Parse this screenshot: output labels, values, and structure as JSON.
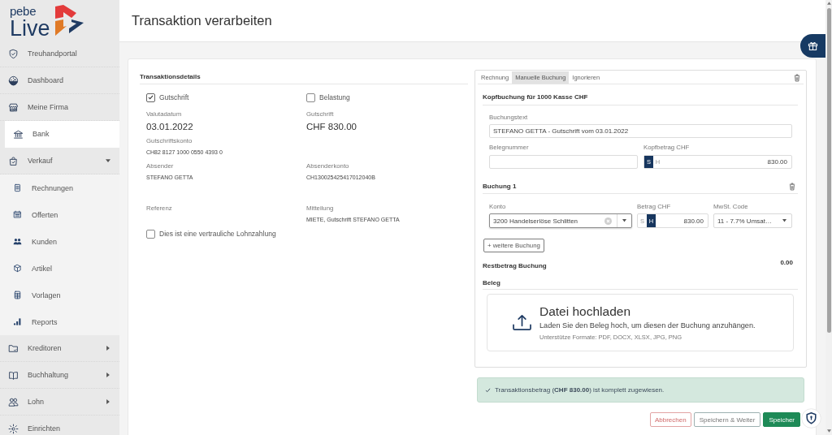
{
  "sidebar": {
    "logo": {
      "top": "pebe",
      "bottom": "Live"
    },
    "items": [
      {
        "label": "Treuhandportal",
        "kind": "link",
        "selected": false
      },
      {
        "label": "Dashboard",
        "kind": "link",
        "selected": false
      },
      {
        "label": "Meine Firma",
        "kind": "link",
        "selected": false
      },
      {
        "label": "Bank",
        "kind": "link",
        "selected": true
      },
      {
        "label": "Verkauf",
        "kind": "group",
        "selected": false,
        "expanded": true,
        "children": [
          {
            "label": "Rechnungen",
            "selected": false
          },
          {
            "label": "Offerten",
            "selected": false
          },
          {
            "label": "Kunden",
            "selected": false
          },
          {
            "label": "Artikel",
            "selected": false
          },
          {
            "label": "Vorlagen",
            "selected": false
          },
          {
            "label": "Reports",
            "selected": false
          }
        ]
      },
      {
        "label": "Kreditoren",
        "kind": "group",
        "selected": false,
        "expanded": false
      },
      {
        "label": "Buchhaltung",
        "kind": "group",
        "selected": false,
        "expanded": false
      },
      {
        "label": "Lohn",
        "kind": "group",
        "selected": false,
        "expanded": false
      },
      {
        "label": "Einrichten",
        "kind": "link",
        "selected": false
      }
    ]
  },
  "header": {
    "title": "Transaktion verarbeiten"
  },
  "details": {
    "title": "Transaktionsdetails",
    "types": [
      {
        "label": "Gutschrift",
        "checked": true
      },
      {
        "label": "Belastung",
        "checked": false
      }
    ],
    "rows": [
      [
        {
          "label": "Valutadatum",
          "value": "03.01.2022",
          "kind": "large"
        },
        {
          "label": "Gutschrift",
          "value": "CHF 830.00",
          "kind": "large"
        }
      ],
      [
        {
          "label": "Gutschriftskonto",
          "value": "CH82 8127 1000 0550 4393 0",
          "kind": "small"
        }
      ],
      [
        {
          "label": "Absender",
          "value": "STEFANO GETTA",
          "kind": "small"
        },
        {
          "label": "Absenderkonto",
          "value": "CH130025425417012040B",
          "kind": "small"
        }
      ],
      [
        {
          "label": "Referenz"
        },
        {
          "label": "Mitteilung",
          "value": "MIETE, Gutschrift STEFANO GETTA",
          "kind": "small"
        }
      ]
    ],
    "confidential": {
      "label": "Dies ist eine vertrauliche Lohnzahlung",
      "checked": false
    }
  },
  "booking": {
    "tabs": [
      {
        "label": "Rechnung",
        "selected": false
      },
      {
        "label": "Manuelle Buchung",
        "selected": true
      },
      {
        "label": "Ignorieren",
        "selected": false
      }
    ],
    "head": {
      "title": "Kopfbuchung für 1000 Kasse CHF",
      "text": {
        "label": "Buchungstext",
        "value": "STEFANO GETTA - Gutschrift vom 03.01.2022"
      },
      "voucher": {
        "label": "Belegnummer"
      },
      "amount": {
        "label": "Kopfbetrag CHF",
        "sides": [
          {
            "label": "S",
            "selected": true
          },
          {
            "label": "H",
            "selected": false
          }
        ],
        "value": "830.00"
      }
    },
    "entries": [
      {
        "title": "Buchung 1",
        "account": {
          "label": "Konto",
          "value": "3200 Handelserlöse Schlitten",
          "focused": true
        },
        "amount": {
          "label": "Betrag CHF",
          "sides": [
            {
              "label": "S",
              "selected": false
            },
            {
              "label": "H",
              "selected": true
            }
          ],
          "value": "830.00"
        },
        "vat": {
          "label": "MwSt. Code",
          "value": "11 - 7.7% Umsat…"
        }
      }
    ],
    "add_button": "+ weitere Buchung",
    "remaining": {
      "label": "Restbetrag Buchung",
      "value": "0.00"
    },
    "receipt": {
      "title": "Beleg",
      "upload_title": "Datei hochladen",
      "upload_text": "Laden Sie den Beleg hoch, um diesen der Buchung anzuhängen.",
      "formats": "Unterstütze Formate: PDF, DOCX, XLSX, JPG, PNG"
    }
  },
  "alert": {
    "text": "Transaktionsbetrag (**CHF 830.00**) ist komplett zugewiesen."
  },
  "actions": [
    {
      "label": "Abbrechen",
      "kind": "cancel"
    },
    {
      "label": "Speichern & Weiter",
      "kind": "secondary"
    },
    {
      "label": "Speicher",
      "kind": "primary"
    }
  ]
}
